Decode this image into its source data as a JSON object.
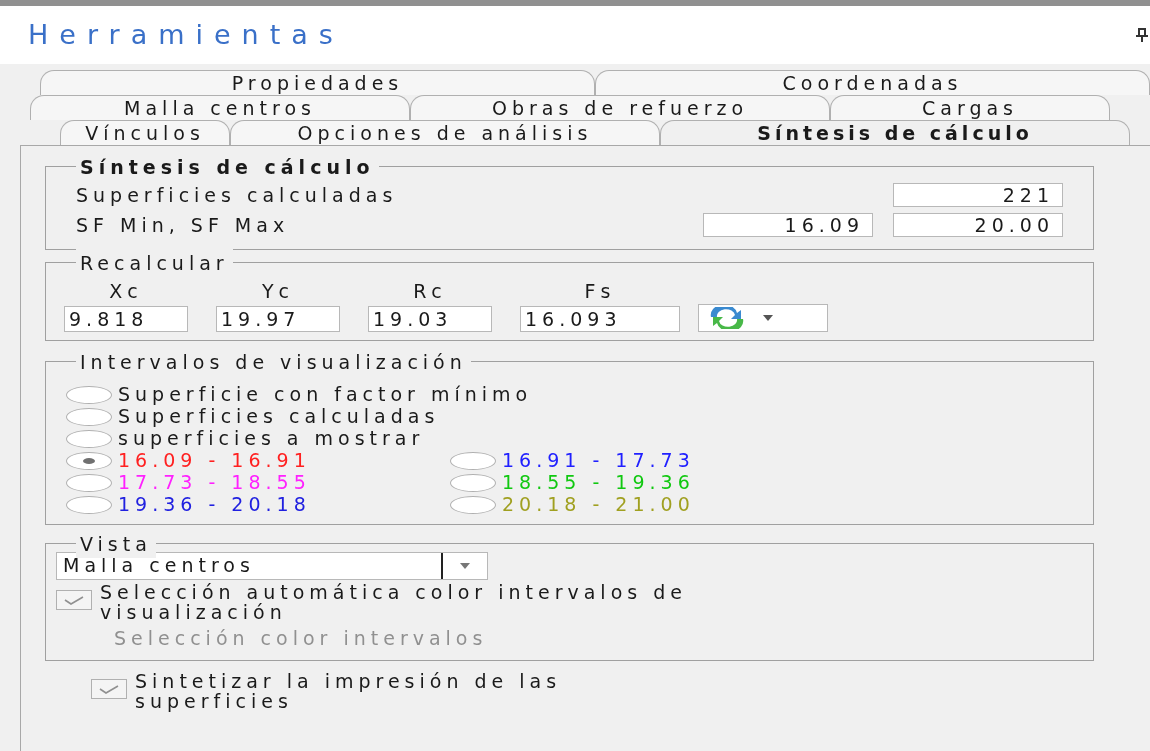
{
  "panel": {
    "title": "Herramientas"
  },
  "tab_rows": [
    [
      {
        "label": "Propiedades",
        "selected": false
      },
      {
        "label": "Coordenadas",
        "selected": false
      }
    ],
    [
      {
        "label": "Malla centros",
        "selected": false
      },
      {
        "label": "Obras de refuerzo",
        "selected": false
      },
      {
        "label": "Cargas",
        "selected": false
      }
    ],
    [
      {
        "label": "Vínculos",
        "selected": false
      },
      {
        "label": "Opciones de análisis",
        "selected": false
      },
      {
        "label": "Síntesis de cálculo",
        "selected": true
      }
    ]
  ],
  "summary": {
    "title": "Síntesis de cálculo",
    "surfaces_label": "Superficies calculadas",
    "surfaces_value": "221",
    "sf_label": "SF Min, SF Max",
    "sf_min": "16.09",
    "sf_max": "20.00"
  },
  "recalc": {
    "title": "Recalcular",
    "fields": [
      {
        "label": "Xc",
        "value": "9.818"
      },
      {
        "label": "Yc",
        "value": "19.97"
      },
      {
        "label": "Rc",
        "value": "19.03"
      },
      {
        "label": "Fs",
        "value": "16.093"
      }
    ]
  },
  "intervals": {
    "title": "Intervalos de visualización",
    "options": [
      {
        "label": "Superficie con factor mínimo",
        "selected": false
      },
      {
        "label": "Superficies calculadas",
        "selected": false
      },
      {
        "label": "superficies a mostrar",
        "selected": false
      }
    ],
    "ranges": [
      {
        "label": "16.09 - 16.91",
        "color": "#ff2020",
        "selected": true
      },
      {
        "label": "16.91 - 17.73",
        "color": "#2020ff",
        "selected": false
      },
      {
        "label": "17.73 - 18.55",
        "color": "#ff20ff",
        "selected": false
      },
      {
        "label": "18.55 - 19.36",
        "color": "#10c810",
        "selected": false
      },
      {
        "label": "19.36 - 20.18",
        "color": "#2020e0",
        "selected": false
      },
      {
        "label": "20.18 - 21.00",
        "color": "#a0a020",
        "selected": false
      }
    ]
  },
  "view": {
    "title": "Vista",
    "dropdown": "Malla centros",
    "auto_color": {
      "label": "Selección automática color intervalos de visualización",
      "checked": true,
      "disabled": true
    },
    "color_link": {
      "label": "Selección color intervalos",
      "disabled": true
    }
  },
  "print_summary": {
    "label": "Sintetizar la impresión de las superficies",
    "checked": true,
    "disabled": true
  }
}
